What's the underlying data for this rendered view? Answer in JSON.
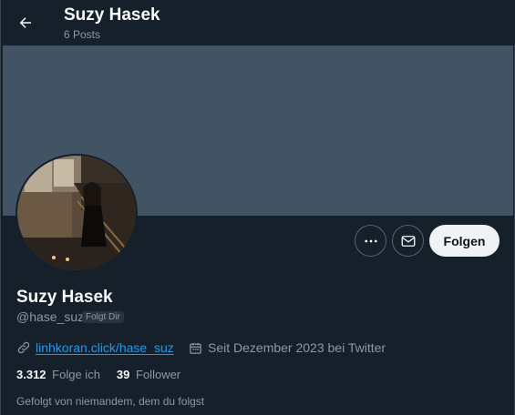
{
  "header": {
    "title": "Suzy Hasek",
    "posts": "6 Posts"
  },
  "profile": {
    "name": "Suzy Hasek",
    "handle": "@hase_suz",
    "follows_you": "Folgt Dir",
    "website": "linhkoran.click/hase_suz",
    "joined": "Seit Dezember 2023 bei Twitter",
    "following_count": "3.312",
    "following_label": "Folge ich",
    "followers_count": "39",
    "followers_label": "Follower",
    "followed_by": "Gefolgt von niemandem, dem du folgst"
  },
  "actions": {
    "follow_label": "Folgen"
  },
  "icons": {
    "back": "arrow-left-icon",
    "more": "more-icon",
    "message": "mail-icon",
    "link": "link-icon",
    "calendar": "calendar-icon"
  },
  "colors": {
    "background": "#15202b",
    "banner": "#425364",
    "accent": "#1d9bf0",
    "follow_button": "#eff3f4"
  }
}
